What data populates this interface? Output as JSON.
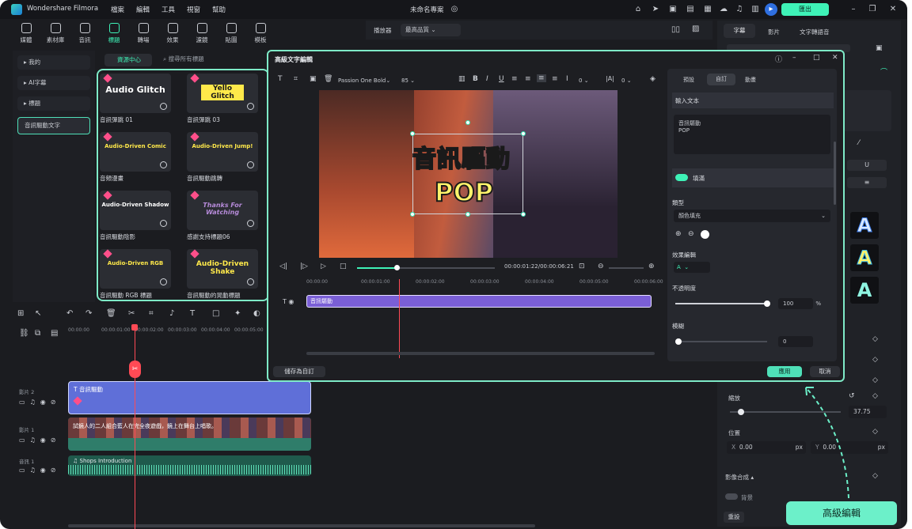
{
  "app": {
    "name": "Wondershare Filmora",
    "menus": [
      "檔案",
      "編輯",
      "工具",
      "視窗",
      "幫助"
    ],
    "project": "未命名專案",
    "export": "匯出"
  },
  "toolbar": [
    {
      "label": "媒體",
      "icon": "media-icon"
    },
    {
      "label": "素材庫",
      "icon": "store-icon"
    },
    {
      "label": "音訊",
      "icon": "music-icon"
    },
    {
      "label": "標題",
      "icon": "title-icon",
      "active": true
    },
    {
      "label": "轉場",
      "icon": "transition-icon"
    },
    {
      "label": "效果",
      "icon": "effects-icon"
    },
    {
      "label": "濾鏡",
      "icon": "filter-icon"
    },
    {
      "label": "貼圖",
      "icon": "sticker-icon"
    },
    {
      "label": "模板",
      "icon": "template-icon"
    }
  ],
  "library": {
    "nav": [
      "我的",
      "AI字幕",
      "標題",
      "音訊驅動文字"
    ],
    "tab": "資源中心",
    "search_placeholder": "搜尋所有標題",
    "cards": [
      {
        "title": "Audio Glitch",
        "caption": "音訊彈跳 01"
      },
      {
        "title": "Yello Glitch",
        "caption": "音訊彈跳 03"
      },
      {
        "title": "Audio-Driven Comic",
        "caption": "音頻漫畫"
      },
      {
        "title": "Audio-Driven Jump!",
        "caption": "音訊驅動跳轉"
      },
      {
        "title": "Audio-Driven Shadow",
        "caption": "音訊驅動陰影"
      },
      {
        "title": "Thanks For Watching",
        "caption": "感謝支持標題06"
      },
      {
        "title": "Audio-Driven RGB",
        "caption": "音訊驅動 RGB 標題"
      },
      {
        "title": "Audio-Driven Shake",
        "caption": "音訊驅動的晃動標題"
      }
    ]
  },
  "player": {
    "label": "播放器",
    "quality": "最高品質"
  },
  "right_panel": {
    "tabs": [
      "字幕",
      "影片",
      "文字轉語音"
    ],
    "scale_label": "縮放",
    "scale_value": "37.75",
    "position_label": "位置",
    "x": "0.00",
    "y": "0.00",
    "unit": "px",
    "blend": "影像合成",
    "bg_label": "背景",
    "reset": "重設",
    "adv_button": "高級編輯"
  },
  "dialog": {
    "title": "高級文字編輯",
    "font": "Passion One Bold",
    "size": "85",
    "spacing1": "0",
    "spacing2": "0",
    "video_text": [
      "音訊驅動",
      "POP"
    ],
    "time": "00:00:01:22/00:00:06:21",
    "ruler": [
      "00:00:00",
      "00:00:01:00",
      "00:00:02:00",
      "00:00:03:00",
      "00:00:04:00",
      "00:00:05:00",
      "00:00:06:00"
    ],
    "clip": "音訊驅動",
    "save_custom": "儲存為自訂",
    "apply": "應用",
    "cancel": "取消",
    "tabs": [
      "預設",
      "自訂",
      "動畫"
    ],
    "input_label": "輸入文本",
    "input_text": "音訊驅動\nPOP",
    "fill_label": "填滿",
    "type_label": "類型",
    "fill_type": "顏色填充",
    "effect_label": "效果編輯",
    "opacity_label": "不透明度",
    "opacity_value": "100",
    "opacity_unit": "%",
    "blur_label": "模糊",
    "blur_value": "0"
  },
  "timeline": {
    "ruler": [
      "00:00:00",
      "00:00:01:00",
      "00:00:02:00",
      "00:00:03:00",
      "00:00:04:00",
      "00:00:05:00"
    ],
    "tracks": [
      {
        "name": "影片 2",
        "clip": "音訊驅動"
      },
      {
        "name": "影片 1",
        "clip": "試鏡人的二人組合藍人在完全夜遊戲，鏡上在舞台上唱歌。"
      },
      {
        "name": "音訊 1",
        "clip": "Shops Introduction"
      }
    ]
  }
}
